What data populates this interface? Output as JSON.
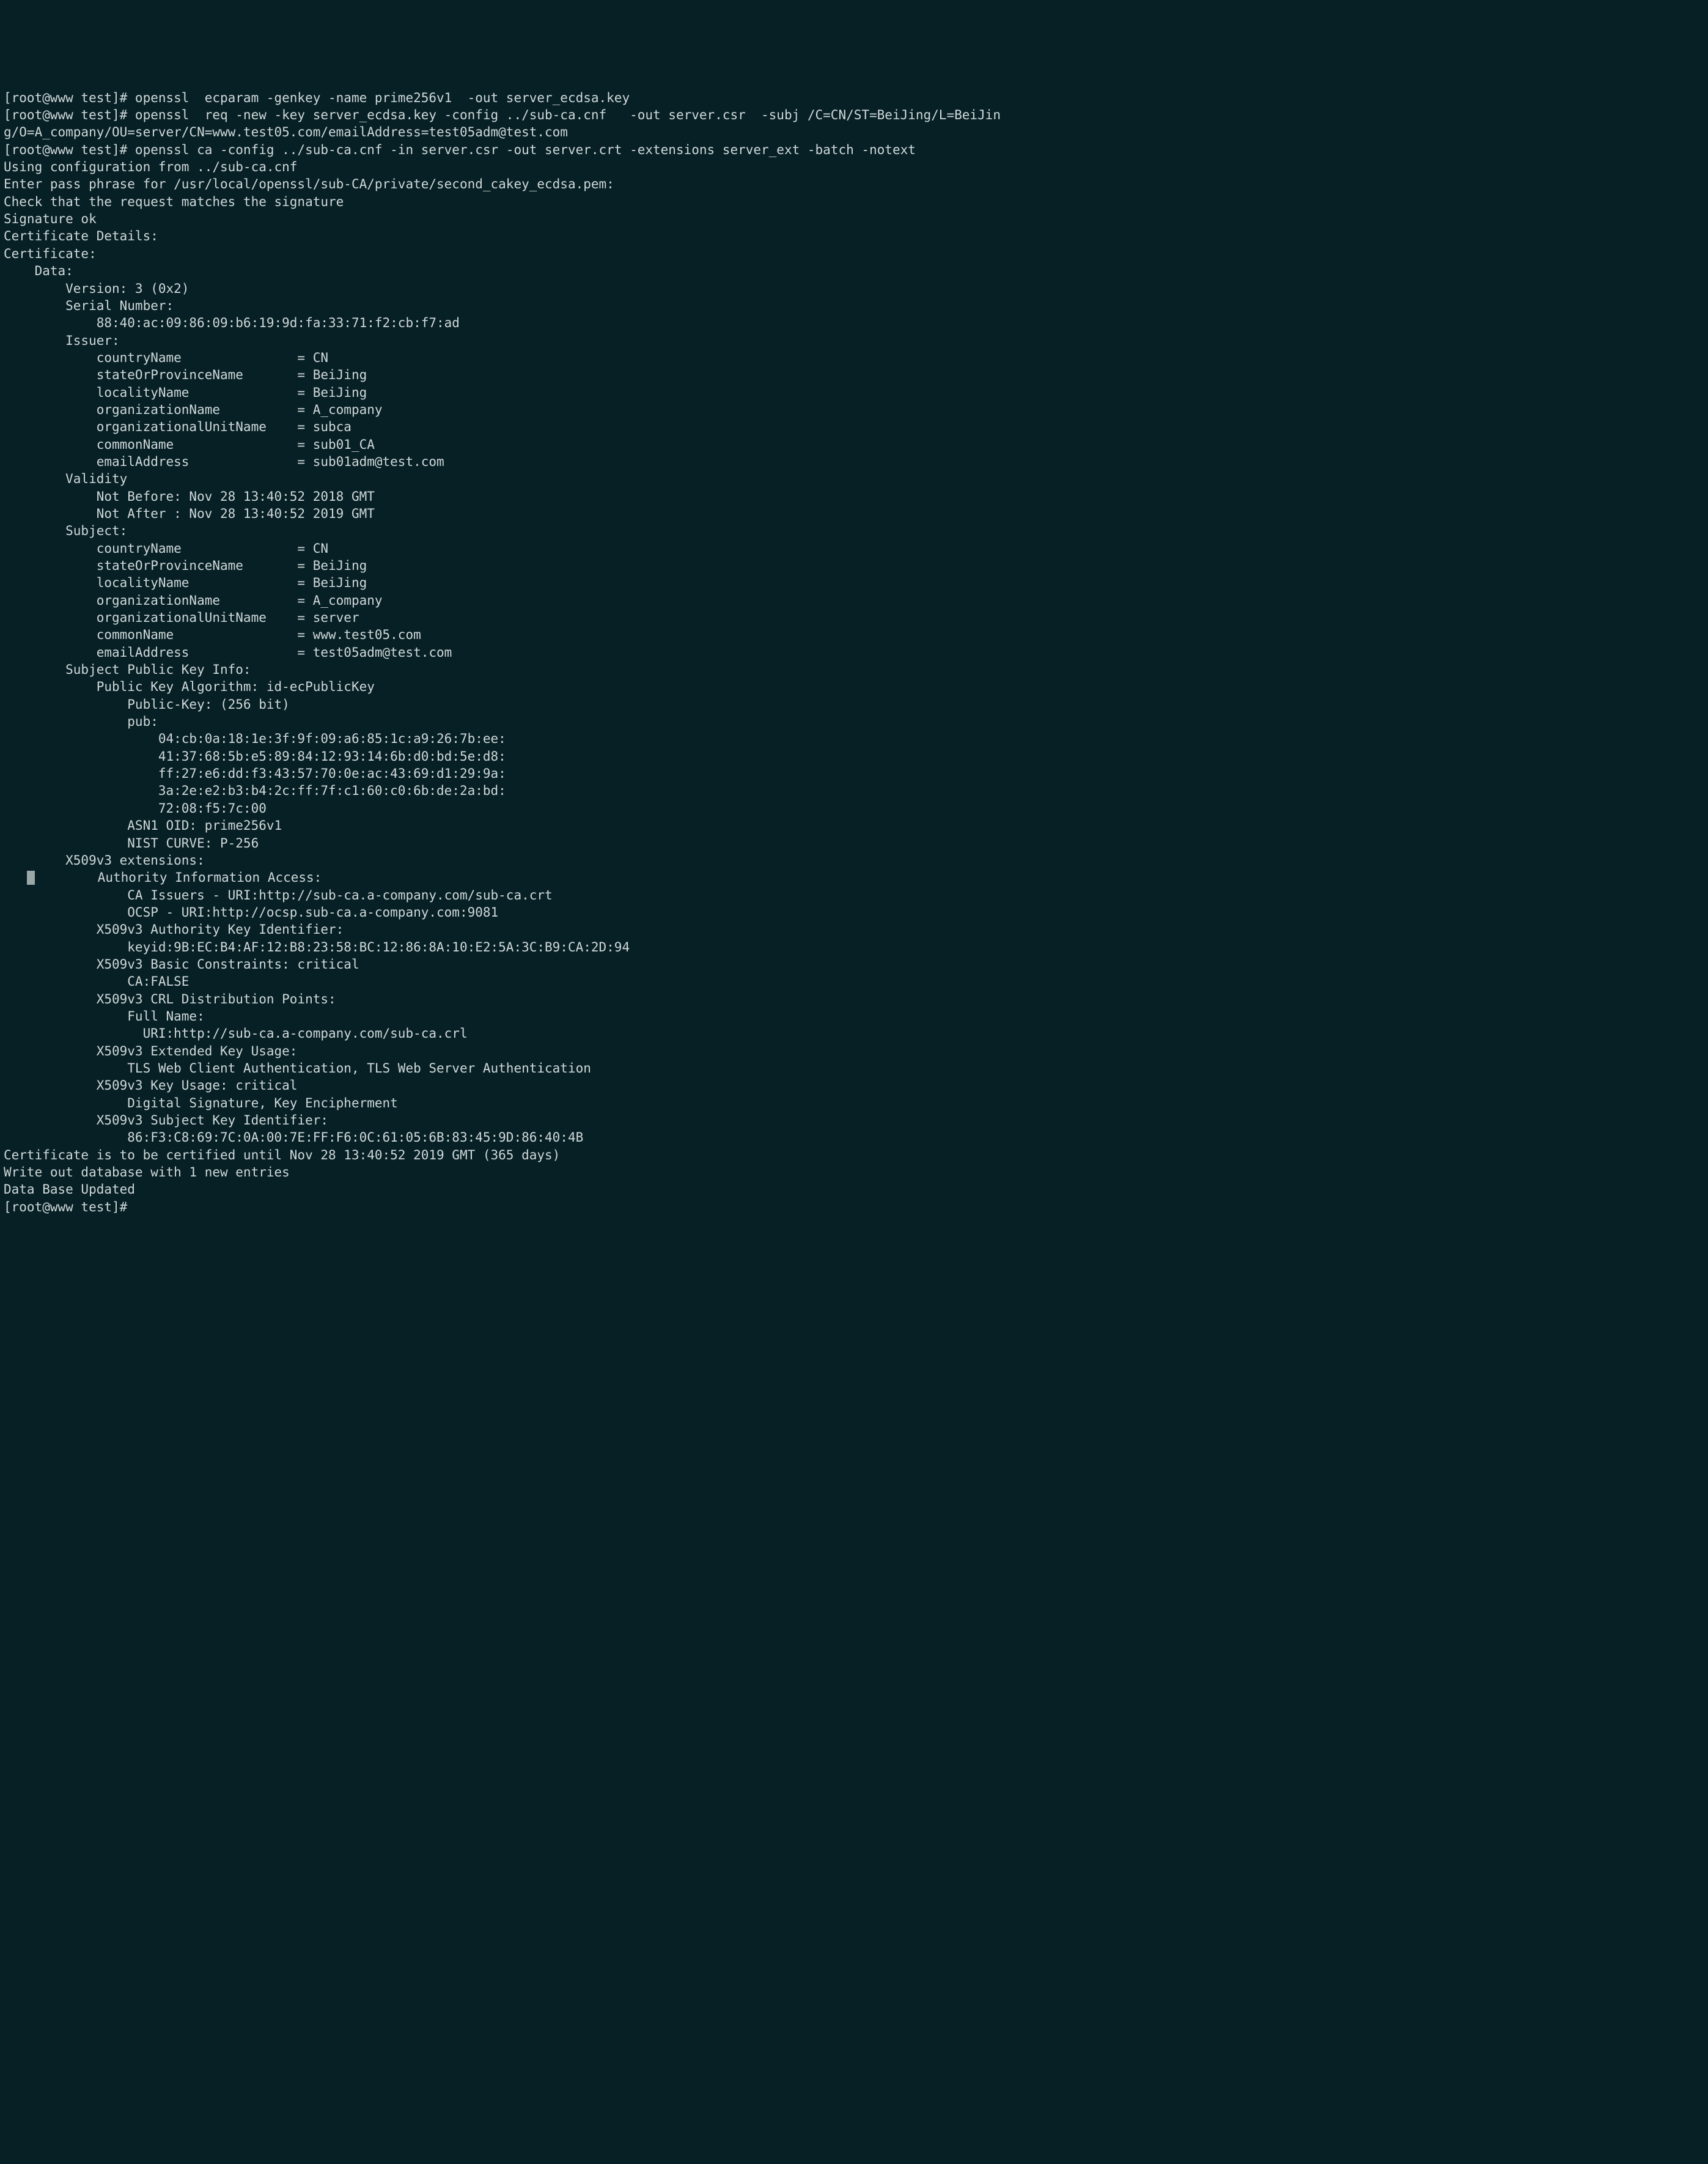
{
  "lines": {
    "l0": "[root@www test]# openssl  ecparam -genkey -name prime256v1  -out server_ecdsa.key",
    "l1": "[root@www test]# openssl  req -new -key server_ecdsa.key -config ../sub-ca.cnf   -out server.csr  -subj /C=CN/ST=BeiJing/L=BeiJin",
    "l2": "g/O=A_company/OU=server/CN=www.test05.com/emailAddress=test05adm@test.com",
    "l3": "[root@www test]# openssl ca -config ../sub-ca.cnf -in server.csr -out server.crt -extensions server_ext -batch -notext",
    "l4": "Using configuration from ../sub-ca.cnf",
    "l5": "Enter pass phrase for /usr/local/openssl/sub-CA/private/second_cakey_ecdsa.pem:",
    "l6": "Check that the request matches the signature",
    "l7": "Signature ok",
    "l8": "Certificate Details:",
    "l9": "Certificate:",
    "l10": "    Data:",
    "l11": "        Version: 3 (0x2)",
    "l12": "        Serial Number:",
    "l13": "            88:40:ac:09:86:09:b6:19:9d:fa:33:71:f2:cb:f7:ad",
    "l14": "        Issuer:",
    "l15": "            countryName               = CN",
    "l16": "            stateOrProvinceName       = BeiJing",
    "l17": "            localityName              = BeiJing",
    "l18": "            organizationName          = A_company",
    "l19": "            organizationalUnitName    = subca",
    "l20": "            commonName                = sub01_CA",
    "l21": "            emailAddress              = sub01adm@test.com",
    "l22": "        Validity",
    "l23": "            Not Before: Nov 28 13:40:52 2018 GMT",
    "l24": "            Not After : Nov 28 13:40:52 2019 GMT",
    "l25": "        Subject:",
    "l26": "            countryName               = CN",
    "l27": "            stateOrProvinceName       = BeiJing",
    "l28": "            localityName              = BeiJing",
    "l29": "            organizationName          = A_company",
    "l30": "            organizationalUnitName    = server",
    "l31": "            commonName                = www.test05.com",
    "l32": "            emailAddress              = test05adm@test.com",
    "l33": "        Subject Public Key Info:",
    "l34": "            Public Key Algorithm: id-ecPublicKey",
    "l35": "                Public-Key: (256 bit)",
    "l36": "                pub:",
    "l37": "                    04:cb:0a:18:1e:3f:9f:09:a6:85:1c:a9:26:7b:ee:",
    "l38": "                    41:37:68:5b:e5:89:84:12:93:14:6b:d0:bd:5e:d8:",
    "l39": "                    ff:27:e6:dd:f3:43:57:70:0e:ac:43:69:d1:29:9a:",
    "l40": "                    3a:2e:e2:b3:b4:2c:ff:7f:c1:60:c0:6b:de:2a:bd:",
    "l41": "                    72:08:f5:7c:00",
    "l42": "                ASN1 OID: prime256v1",
    "l43": "                NIST CURVE: P-256",
    "l44": "        X509v3 extensions:",
    "l45a": "   ",
    "l45b": "        Authority Information Access: ",
    "l46": "                CA Issuers - URI:http://sub-ca.a-company.com/sub-ca.crt",
    "l47": "                OCSP - URI:http://ocsp.sub-ca.a-company.com:9081",
    "l48": "",
    "l49": "            X509v3 Authority Key Identifier: ",
    "l50": "                keyid:9B:EC:B4:AF:12:B8:23:58:BC:12:86:8A:10:E2:5A:3C:B9:CA:2D:94",
    "l51": "",
    "l52": "            X509v3 Basic Constraints: critical",
    "l53": "                CA:FALSE",
    "l54": "            X509v3 CRL Distribution Points: ",
    "l55": "",
    "l56": "                Full Name:",
    "l57": "                  URI:http://sub-ca.a-company.com/sub-ca.crl",
    "l58": "",
    "l59": "            X509v3 Extended Key Usage: ",
    "l60": "                TLS Web Client Authentication, TLS Web Server Authentication",
    "l61": "            X509v3 Key Usage: critical",
    "l62": "                Digital Signature, Key Encipherment",
    "l63": "            X509v3 Subject Key Identifier: ",
    "l64": "                86:F3:C8:69:7C:0A:00:7E:FF:F6:0C:61:05:6B:83:45:9D:86:40:4B",
    "l65": "Certificate is to be certified until Nov 28 13:40:52 2019 GMT (365 days)",
    "l66": "",
    "l67": "Write out database with 1 new entries",
    "l68": "Data Base Updated",
    "l69": "[root@www test]# "
  }
}
